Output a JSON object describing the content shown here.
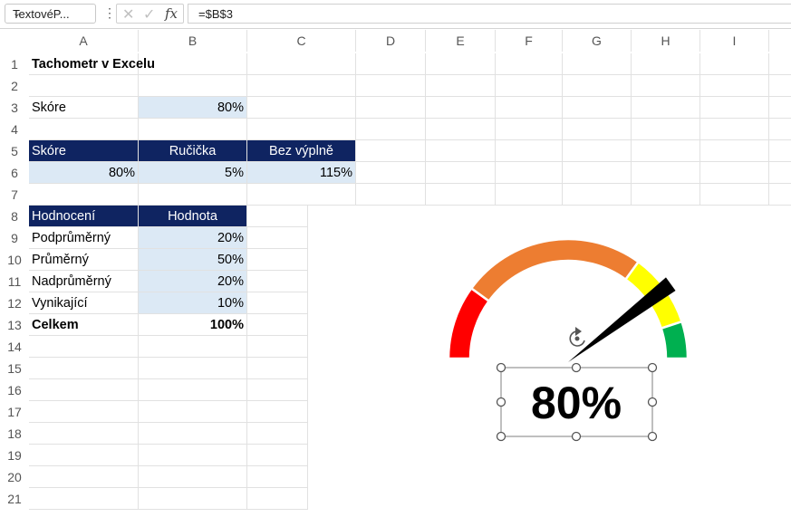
{
  "formula_bar": {
    "name_box": "TextovéP...",
    "formula": "=$B$3"
  },
  "columns": [
    "A",
    "B",
    "C",
    "D",
    "E",
    "F",
    "G",
    "H",
    "I"
  ],
  "rows": [
    "1",
    "2",
    "3",
    "4",
    "5",
    "6",
    "7",
    "8",
    "9",
    "10",
    "11",
    "12",
    "13",
    "14",
    "15",
    "16",
    "17",
    "18",
    "19",
    "20",
    "21"
  ],
  "sheet": {
    "title": "Tachometr v Excelu",
    "score_label": "Skóre",
    "score_value": "80%",
    "table1": {
      "headers": [
        "Skóre",
        "Ručička",
        "Bez výplně"
      ],
      "values": [
        "80%",
        "5%",
        "115%"
      ]
    },
    "table2": {
      "headers": [
        "Hodnocení",
        "Hodnota"
      ],
      "rows": [
        {
          "label": "Podprůměrný",
          "value": "20%"
        },
        {
          "label": "Průměrný",
          "value": "50%"
        },
        {
          "label": "Nadprůměrný",
          "value": "20%"
        },
        {
          "label": "Vynikající",
          "value": "10%"
        }
      ],
      "total_label": "Celkem",
      "total_value": "100%"
    }
  },
  "gauge": {
    "display": "80%",
    "needle_value": 0.8,
    "segments": [
      {
        "name": "Podprůměrný",
        "share": 0.2,
        "color": "#ff0000"
      },
      {
        "name": "Průměrný",
        "share": 0.5,
        "color": "#ed7d31"
      },
      {
        "name": "Nadprůměrný",
        "share": 0.2,
        "color": "#ffff00"
      },
      {
        "name": "Vynikající",
        "share": 0.1,
        "color": "#00b050"
      }
    ]
  }
}
